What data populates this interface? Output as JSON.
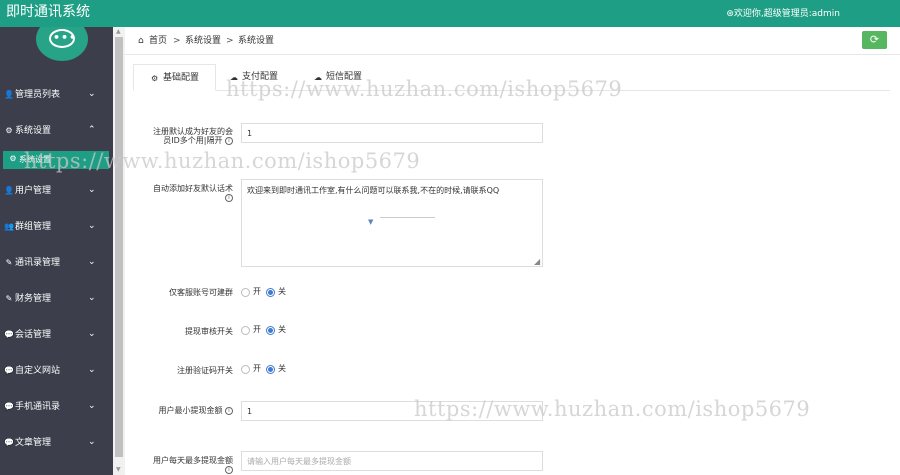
{
  "header": {
    "title": "即时通讯系统",
    "welcome": "⊛欢迎你,超级管理员:admin"
  },
  "sidebar": {
    "items": [
      {
        "label": "管理员列表",
        "icon": "user-icon",
        "glyph": "👤"
      },
      {
        "label": "系统设置",
        "icon": "gear-icon",
        "glyph": "⚙"
      },
      {
        "label": "用户管理",
        "icon": "user-icon",
        "glyph": "👤"
      },
      {
        "label": "群组管理",
        "icon": "users-icon",
        "glyph": "👥"
      },
      {
        "label": "通讯录管理",
        "icon": "edit-icon",
        "glyph": "✎"
      },
      {
        "label": "财务管理",
        "icon": "edit-icon",
        "glyph": "✎"
      },
      {
        "label": "会话管理",
        "icon": "chat-icon",
        "glyph": "💬"
      },
      {
        "label": "自定义网站",
        "icon": "chat-icon",
        "glyph": "💬"
      },
      {
        "label": "手机通讯录",
        "icon": "chat-icon",
        "glyph": "💬"
      },
      {
        "label": "文章管理",
        "icon": "chat-icon",
        "glyph": "💬"
      }
    ],
    "active_sub": {
      "label": "系统设置",
      "icon": "gear-icon",
      "glyph": "⚙"
    }
  },
  "breadcrumb": {
    "items": [
      "首页",
      "系统设置",
      "系统设置"
    ],
    "separator": ">"
  },
  "tabs": [
    {
      "label": "基础配置",
      "glyph": "⚙"
    },
    {
      "label": "支付配置",
      "glyph": "☁"
    },
    {
      "label": "短信配置",
      "glyph": "☁"
    }
  ],
  "form": {
    "default_friend_label": "注册默认成为好友的会员ID多个用|隔开",
    "default_friend_value": "1",
    "auto_greeting_label": "自动添加好友默认话术",
    "auto_greeting_value": "欢迎来到即时通讯工作室,有什么问题可以联系我,不在的时候,请联系QQ",
    "customer_service_group_label": "仅客服账号可建群",
    "withdraw_review_label": "提现审核开关",
    "register_verify_label": "注册验证码开关",
    "min_withdraw_label": "用户最小提现金额",
    "min_withdraw_value": "1",
    "max_daily_withdraw_label": "用户每天最多提现金额",
    "max_daily_withdraw_placeholder": "请输入用户每天最多提现金额",
    "radio_on": "开",
    "radio_off": "关"
  },
  "watermark": "https://www.huzhan.com/ishop5679",
  "colors": {
    "accent": "#1e9f85",
    "sidebar": "#3c3f4b",
    "refresh_button": "#56b760",
    "radio_checked": "#3e7bd2"
  }
}
